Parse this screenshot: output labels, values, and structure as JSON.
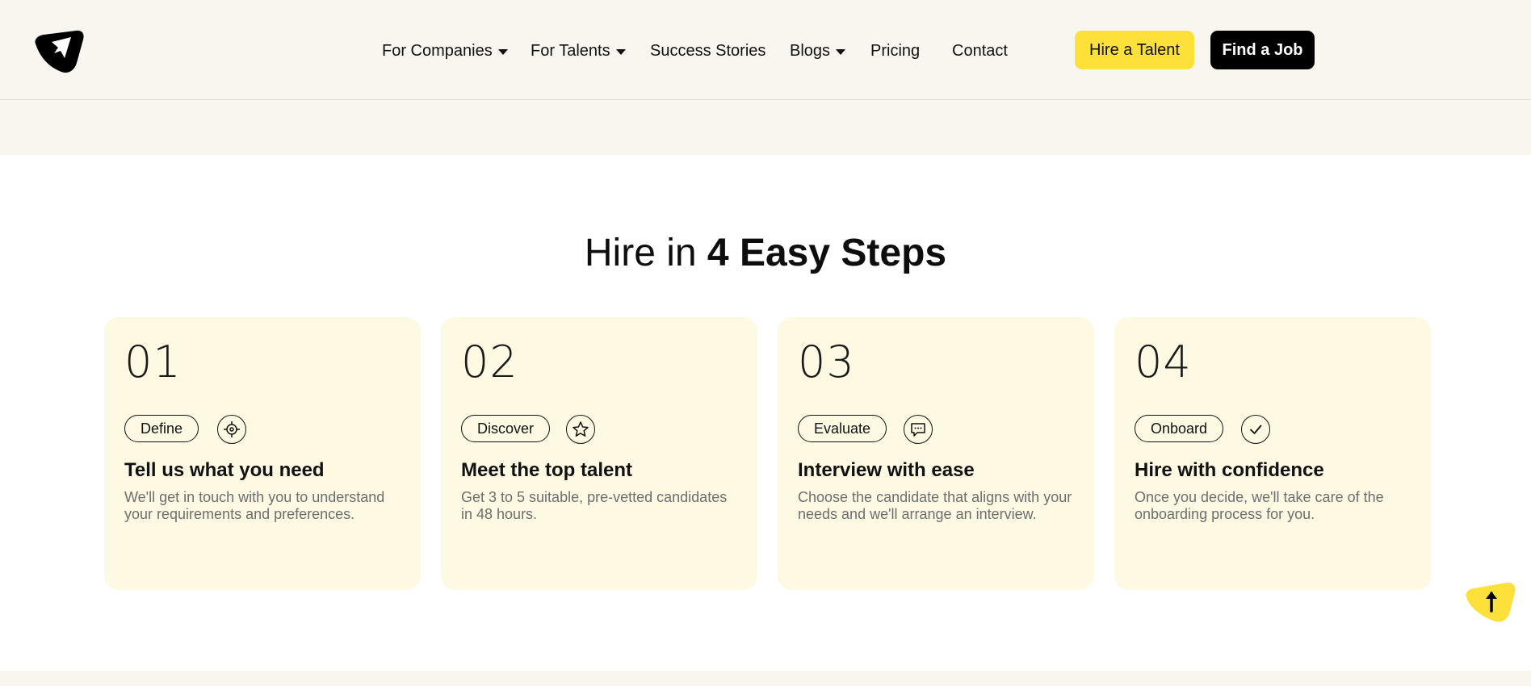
{
  "nav": {
    "items": [
      {
        "label": "For Companies",
        "dropdown": true
      },
      {
        "label": "For Talents",
        "dropdown": true
      },
      {
        "label": "Success Stories",
        "dropdown": false
      },
      {
        "label": "Blogs",
        "dropdown": true
      },
      {
        "label": "Pricing",
        "dropdown": false
      },
      {
        "label": "Contact",
        "dropdown": false
      }
    ],
    "hire_button": "Hire a Talent",
    "job_button": "Find a Job"
  },
  "section": {
    "heading_light": "Hire in ",
    "heading_bold": "4 Easy Steps"
  },
  "steps": [
    {
      "number": "01",
      "tag": "Define",
      "icon": "target-icon",
      "title": "Tell us what you need",
      "description": "We'll get in touch with you to understand your requirements and preferences."
    },
    {
      "number": "02",
      "tag": "Discover",
      "icon": "star-icon",
      "title": "Meet the top talent",
      "description": "Get 3 to 5 suitable, pre-vetted candidates in 48 hours."
    },
    {
      "number": "03",
      "tag": "Evaluate",
      "icon": "chat-icon",
      "title": "Interview with ease",
      "description": "Choose the candidate that aligns with your needs and we'll arrange an interview."
    },
    {
      "number": "04",
      "tag": "Onboard",
      "icon": "check-icon",
      "title": "Hire with confidence",
      "description": "Once you decide, we'll take care of the onboarding process for you."
    }
  ],
  "colors": {
    "accent": "#fde03a",
    "card_bg": "#fdf9e3",
    "header_bg": "#f8f6ef"
  }
}
